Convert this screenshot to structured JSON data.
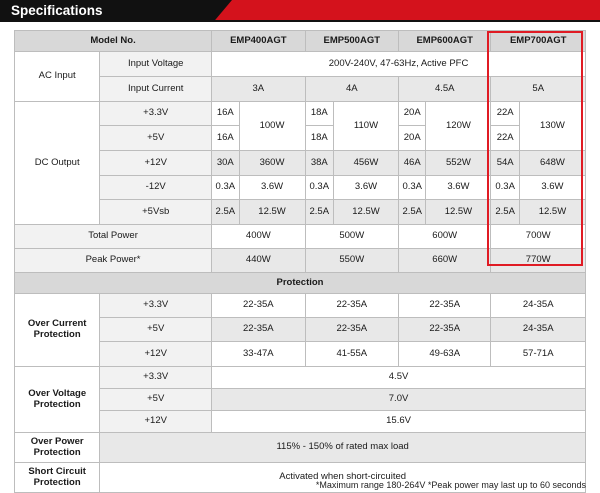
{
  "header": {
    "title": "Specifications"
  },
  "columns": {
    "model_label": "Model No.",
    "models": [
      "EMP400AGT",
      "EMP500AGT",
      "EMP600AGT",
      "EMP700AGT"
    ]
  },
  "ac_input": {
    "label": "AC Input",
    "voltage_label": "Input Voltage",
    "voltage_value": "200V-240V, 47-63Hz, Active PFC",
    "current_label": "Input Current",
    "currents": [
      "3A",
      "4A",
      "4.5A",
      "5A"
    ]
  },
  "dc_output": {
    "label": "DC Output",
    "rails": [
      "+3.3V",
      "+5V",
      "+12V",
      "-12V",
      "+5Vsb"
    ],
    "r33_amps": [
      "16A",
      "18A",
      "20A",
      "22A"
    ],
    "r5_amps": [
      "16A",
      "18A",
      "20A",
      "22A"
    ],
    "combined_watts": [
      "100W",
      "110W",
      "120W",
      "130W"
    ],
    "r12_amps": [
      "30A",
      "38A",
      "46A",
      "54A"
    ],
    "r12_watts": [
      "360W",
      "456W",
      "552W",
      "648W"
    ],
    "rm12_amps": [
      "0.3A",
      "0.3A",
      "0.3A",
      "0.3A"
    ],
    "rm12_watts": [
      "3.6W",
      "3.6W",
      "3.6W",
      "3.6W"
    ],
    "r5sb_amps": [
      "2.5A",
      "2.5A",
      "2.5A",
      "2.5A"
    ],
    "r5sb_watts": [
      "12.5W",
      "12.5W",
      "12.5W",
      "12.5W"
    ]
  },
  "total_power": {
    "label": "Total Power",
    "values": [
      "400W",
      "500W",
      "600W",
      "700W"
    ]
  },
  "peak_power": {
    "label": "Peak Power*",
    "values": [
      "440W",
      "550W",
      "660W",
      "770W"
    ]
  },
  "protection": {
    "title": "Protection",
    "ocp": {
      "label": "Over Current Protection",
      "rails": [
        "+3.3V",
        "+5V",
        "+12V"
      ],
      "r33": [
        "22-35A",
        "22-35A",
        "22-35A",
        "24-35A"
      ],
      "r5": [
        "22-35A",
        "22-35A",
        "22-35A",
        "24-35A"
      ],
      "r12": [
        "33-47A",
        "41-55A",
        "49-63A",
        "57-71A"
      ]
    },
    "ovp": {
      "label": "Over Voltage Protection",
      "rails": [
        "+3.3V",
        "+5V",
        "+12V"
      ],
      "values": [
        "4.5V",
        "7.0V",
        "15.6V"
      ]
    },
    "opp": {
      "label": "Over Power Protection",
      "value": "115% - 150% of rated max load"
    },
    "scp": {
      "label": "Short Circuit Protection",
      "value": "Activated when short-circuited"
    }
  },
  "footnote": "*Maximum range 180-264V  *Peak power may last up to 60 seconds",
  "colors": {
    "accent": "#d4121c",
    "highlight": "#e01b24",
    "header_bg": "#d8d8d8"
  }
}
